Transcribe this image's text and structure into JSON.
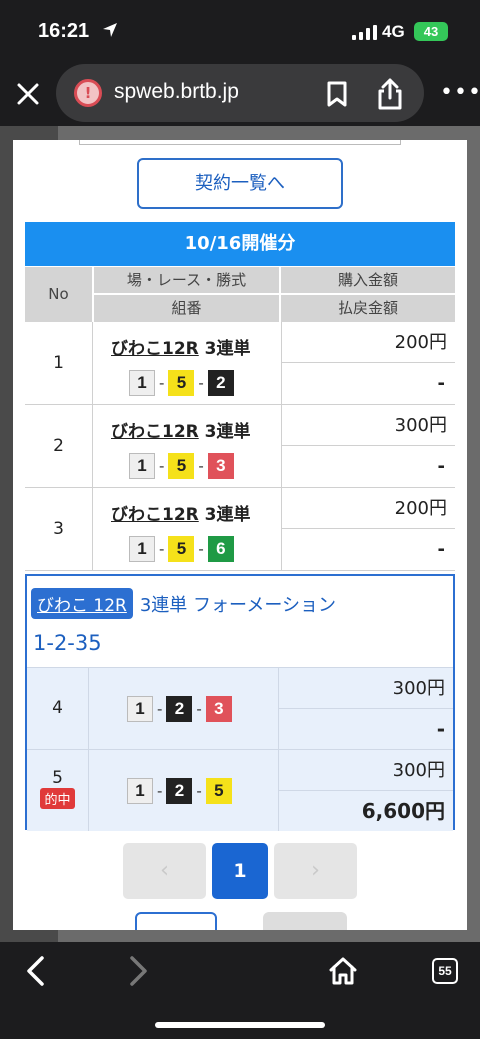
{
  "status": {
    "time": "16:21",
    "network": "4G",
    "battery": "43"
  },
  "browser": {
    "url": "spweb.brtb.jp",
    "tab_count": "55"
  },
  "modal": {
    "contract_button": "契約一覧へ",
    "day_header": "10/16開催分",
    "headers": {
      "no": "No",
      "race_type": "場・レース・勝式",
      "combination": "組番",
      "purchase": "購入金額",
      "payout": "払戻金額"
    },
    "rows": [
      {
        "no": "1",
        "venue": "びわこ12R",
        "type": "3連単",
        "c1": "1",
        "c2": "5",
        "c3": "2",
        "amount": "200円",
        "payout": "-"
      },
      {
        "no": "2",
        "venue": "びわこ12R",
        "type": "3連単",
        "c1": "1",
        "c2": "5",
        "c3": "3",
        "amount": "300円",
        "payout": "-"
      },
      {
        "no": "3",
        "venue": "びわこ12R",
        "type": "3連単",
        "c1": "1",
        "c2": "5",
        "c3": "6",
        "amount": "200円",
        "payout": "-"
      }
    ],
    "formation": {
      "tag": "びわこ 12R",
      "type": "3連単 フォーメーション",
      "combo": "1-2-35",
      "rows": [
        {
          "no": "4",
          "c1": "1",
          "c2": "2",
          "c3": "3",
          "amount": "300円",
          "payout": "-"
        },
        {
          "no": "5",
          "hit": "的中",
          "c1": "1",
          "c2": "2",
          "c3": "5",
          "amount": "300円",
          "payout": "6,600円"
        }
      ]
    },
    "pager": {
      "prev": "‹",
      "current": "1",
      "next": "›"
    }
  },
  "colors": {
    "accent": "#1a8ff0",
    "primary": "#1a66d2",
    "hit": "#e03a3a"
  }
}
